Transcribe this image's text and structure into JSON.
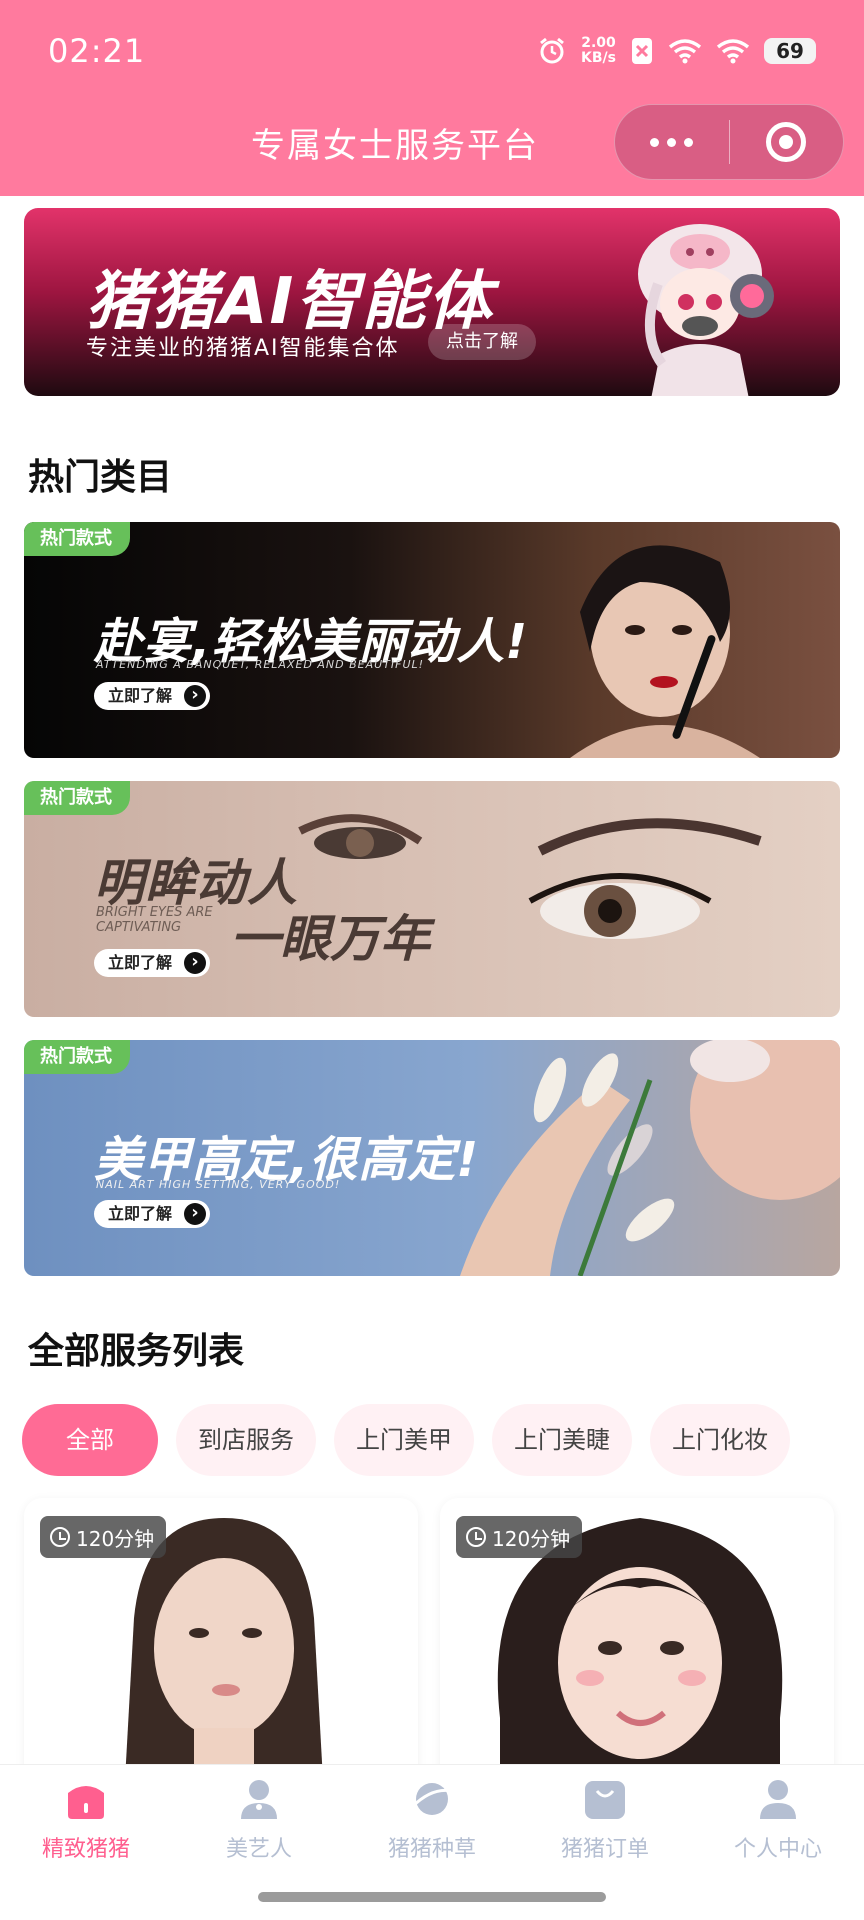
{
  "status_bar": {
    "time": "02:21",
    "net_speed_value": "2.00",
    "net_speed_unit": "KB/s",
    "battery": "69"
  },
  "header": {
    "title": "专属女士服务平台"
  },
  "ai_banner": {
    "title": "猪猪AI智能体",
    "subtitle": "专注美业的猪猪AI智能集合体",
    "button": "点击了解"
  },
  "hot_section": {
    "title": "热门类目",
    "banners": [
      {
        "tag": "热门款式",
        "title": "赴宴,轻松美丽动人!",
        "subtitle": "ATTENDING A BANQUET, RELAXED AND BEAUTIFUL!",
        "button": "立即了解"
      },
      {
        "tag": "热门款式",
        "title_line1": "明眸动人",
        "title_line2": "一眼万年",
        "subtitle": "BRIGHT EYES ARE CAPTIVATING",
        "button": "立即了解"
      },
      {
        "tag": "热门款式",
        "title": "美甲高定,很高定!",
        "subtitle": "NAIL ART HIGH SETTING, VERY GOOD!",
        "button": "立即了解"
      }
    ]
  },
  "services": {
    "title": "全部服务列表",
    "filters": [
      "全部",
      "到店服务",
      "上门美甲",
      "上门美睫",
      "上门化妆"
    ],
    "active_filter": "全部",
    "cards": [
      {
        "duration": "120分钟"
      },
      {
        "duration": "120分钟"
      }
    ]
  },
  "tabbar": {
    "items": [
      {
        "label": "精致猪猪",
        "icon": "home-icon",
        "active": true
      },
      {
        "label": "美艺人",
        "icon": "artist-icon",
        "active": false
      },
      {
        "label": "猪猪种草",
        "icon": "planet-icon",
        "active": false
      },
      {
        "label": "猪猪订单",
        "icon": "order-bag-icon",
        "active": false
      },
      {
        "label": "个人中心",
        "icon": "user-icon",
        "active": false
      }
    ],
    "active_color": "#ff5f8f",
    "inactive_color": "#b5bfd2"
  },
  "colors": {
    "brand_pink": "#ff7a9e",
    "chip_active": "#ff6b95",
    "hot_tag": "#67c05a"
  }
}
